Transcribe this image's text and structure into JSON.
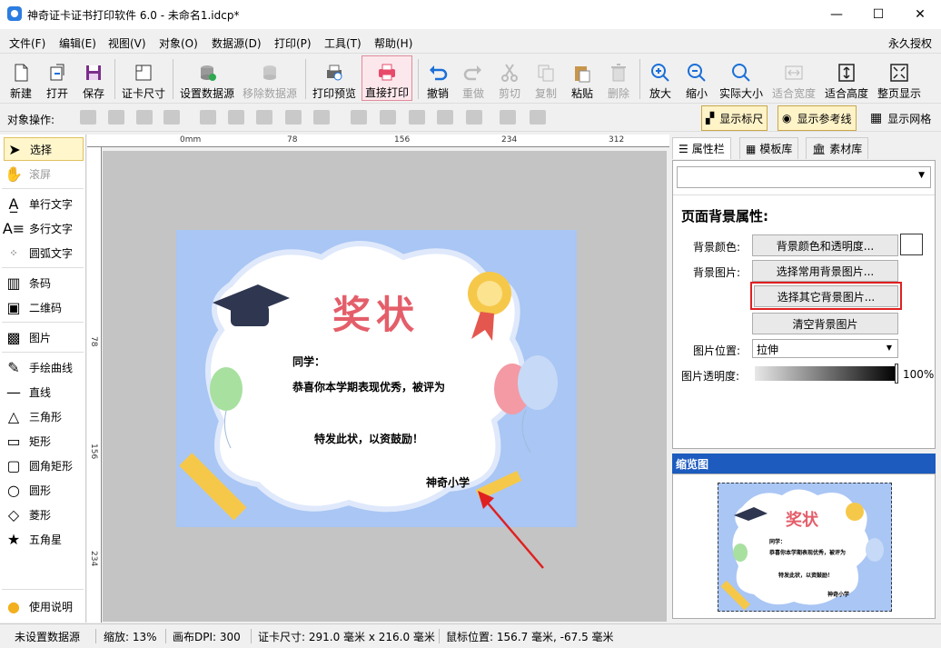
{
  "window": {
    "title": "神奇证卡证书打印软件 6.0 - 未命名1.idcp*",
    "minimize": "—",
    "maximize": "☐",
    "close": "✕"
  },
  "menu": [
    "文件(F)",
    "编辑(E)",
    "视图(V)",
    "对象(O)",
    "数据源(D)",
    "打印(P)",
    "工具(T)",
    "帮助(H)"
  ],
  "license": "永久授权",
  "toolbar": [
    {
      "label": "新建",
      "icon": "new-file-icon",
      "disabled": false
    },
    {
      "label": "打开",
      "icon": "open-icon",
      "disabled": false
    },
    {
      "label": "保存",
      "icon": "save-icon",
      "disabled": false
    },
    {
      "label": "证卡尺寸",
      "icon": "card-size-icon",
      "disabled": false
    },
    {
      "label": "设置数据源",
      "icon": "database-icon",
      "disabled": false
    },
    {
      "label": "移除数据源",
      "icon": "remove-database-icon",
      "disabled": true
    },
    {
      "label": "打印预览",
      "icon": "print-preview-icon",
      "disabled": false
    },
    {
      "label": "直接打印",
      "icon": "printer-icon",
      "disabled": false
    },
    {
      "label": "撤销",
      "icon": "undo-icon",
      "disabled": false
    },
    {
      "label": "重做",
      "icon": "redo-icon",
      "disabled": true
    },
    {
      "label": "剪切",
      "icon": "cut-icon",
      "disabled": true
    },
    {
      "label": "复制",
      "icon": "copy-icon",
      "disabled": true
    },
    {
      "label": "粘贴",
      "icon": "paste-icon",
      "disabled": false
    },
    {
      "label": "删除",
      "icon": "delete-icon",
      "disabled": true
    },
    {
      "label": "放大",
      "icon": "zoom-in-icon",
      "disabled": false
    },
    {
      "label": "缩小",
      "icon": "zoom-out-icon",
      "disabled": false
    },
    {
      "label": "实际大小",
      "icon": "actual-size-icon",
      "disabled": false
    },
    {
      "label": "适合宽度",
      "icon": "fit-width-icon",
      "disabled": true
    },
    {
      "label": "适合高度",
      "icon": "fit-height-icon",
      "disabled": false
    },
    {
      "label": "整页显示",
      "icon": "fit-page-icon",
      "disabled": false
    }
  ],
  "toolbar2": {
    "label": "对象操作:",
    "show_ruler": "显示标尺",
    "show_guides": "显示参考线",
    "show_grid": "显示网格"
  },
  "left_tools": [
    {
      "label": "选择",
      "icon": "arrow-cursor-icon"
    },
    {
      "label": "滚屏",
      "icon": "hand-icon"
    },
    {
      "label": "单行文字",
      "icon": "single-line-text-icon"
    },
    {
      "label": "多行文字",
      "icon": "multi-line-text-icon"
    },
    {
      "label": "圆弧文字",
      "icon": "arc-text-icon"
    },
    {
      "label": "条码",
      "icon": "barcode-icon"
    },
    {
      "label": "二维码",
      "icon": "qrcode-icon"
    },
    {
      "label": "图片",
      "icon": "image-icon"
    },
    {
      "label": "手绘曲线",
      "icon": "pen-icon"
    },
    {
      "label": "直线",
      "icon": "line-icon"
    },
    {
      "label": "三角形",
      "icon": "triangle-icon"
    },
    {
      "label": "矩形",
      "icon": "rectangle-icon"
    },
    {
      "label": "圆角矩形",
      "icon": "rounded-rectangle-icon"
    },
    {
      "label": "圆形",
      "icon": "circle-icon"
    },
    {
      "label": "菱形",
      "icon": "diamond-icon"
    },
    {
      "label": "五角星",
      "icon": "star-icon"
    }
  ],
  "help": "使用说明",
  "ruler_top": [
    "0mm",
    "78",
    "156",
    "234",
    "312"
  ],
  "ruler_left": [
    "78",
    "156",
    "234"
  ],
  "certificate": {
    "title": "奖状",
    "greeting": "同学：",
    "line1": "恭喜你本学期表现优秀，被评为",
    "line2": "特发此状，以资鼓励！",
    "signature": "神奇小学"
  },
  "right_tabs": [
    "属性栏",
    "模板库",
    "素材库"
  ],
  "props": {
    "heading": "页面背景属性:",
    "bg_color_label": "背景颜色:",
    "bg_color_button": "背景颜色和透明度...",
    "bg_image_label": "背景图片:",
    "common_bg_button": "选择常用背景图片...",
    "other_bg_button": "选择其它背景图片...",
    "clear_bg_button": "清空背景图片",
    "image_pos_label": "图片位置:",
    "image_pos_value": "拉伸",
    "opacity_label": "图片透明度:",
    "opacity_value": "100%"
  },
  "thumbnail_title": "缩览图",
  "status": {
    "datasource": "未设置数据源",
    "zoom": "缩放: 13%",
    "dpi": "画布DPI: 300",
    "size": "证卡尺寸: 291.0 毫米 x 216.0 毫米",
    "mouse": "鼠标位置: 156.7 毫米, -67.5 毫米"
  },
  "colors": {
    "accent": "#1d5bbf",
    "page_bg": "#a9c6f4",
    "title_red": "#e45e6a",
    "highlight_red": "#e02020"
  }
}
